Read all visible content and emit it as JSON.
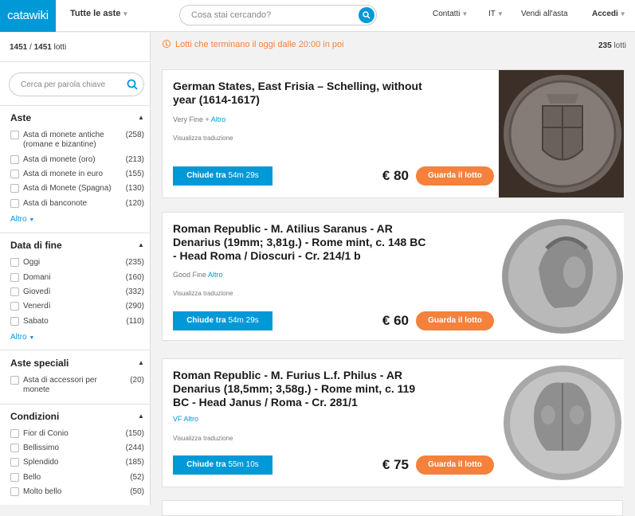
{
  "header": {
    "logo": "catawiki",
    "auctions_menu": "Tutte le aste",
    "search_placeholder": "Cosa stai cercando?",
    "contact": "Contatti",
    "language": "IT",
    "sell": "Vendi all'asta",
    "login": "Accedi"
  },
  "sidebar": {
    "lot_count_shown": "1451",
    "lot_count_total": "1451",
    "lot_word": "lotti",
    "search_placeholder": "Cerca per parola chiave",
    "facets": [
      {
        "title": "Aste",
        "items": [
          {
            "label": "Asta di monete antiche (romane e bizantine)",
            "count": "(258)"
          },
          {
            "label": "Asta di monete (oro)",
            "count": "(213)"
          },
          {
            "label": "Asta di monete in euro",
            "count": "(155)"
          },
          {
            "label": "Asta di Monete (Spagna)",
            "count": "(130)"
          },
          {
            "label": "Asta di banconote",
            "count": "(120)"
          }
        ],
        "more": "Altro"
      },
      {
        "title": "Data di fine",
        "items": [
          {
            "label": "Oggi",
            "count": "(235)"
          },
          {
            "label": "Domani",
            "count": "(160)"
          },
          {
            "label": "Giovedì",
            "count": "(332)"
          },
          {
            "label": "Venerdì",
            "count": "(290)"
          },
          {
            "label": "Sabato",
            "count": "(110)"
          }
        ],
        "more": "Altro"
      },
      {
        "title": "Aste speciali",
        "items": [
          {
            "label": "Asta di accessori per monete",
            "count": "(20)"
          }
        ]
      },
      {
        "title": "Condizioni",
        "items": [
          {
            "label": "Fior di Conio",
            "count": "(150)"
          },
          {
            "label": "Bellissimo",
            "count": "(244)"
          },
          {
            "label": "Splendido",
            "count": "(185)"
          },
          {
            "label": "Bello",
            "count": "(52)"
          },
          {
            "label": "Molto bello",
            "count": "(50)"
          }
        ]
      }
    ]
  },
  "main": {
    "notice": "Lotti che terminano il oggi dalle 20:00 in poi",
    "total_count": "235",
    "total_word": "lotti",
    "lots": [
      {
        "title": "German States, East Frisia – Schelling, without year (1614-1617)",
        "condition": "Very Fine +",
        "more": "Altro",
        "translate": "Visualizza traduzione",
        "timer_label": "Chiude tra",
        "timer_value": "54m 29s",
        "price": "€ 80",
        "cta": "Guarda il lotto",
        "image": "coin-shield-silver"
      },
      {
        "title": "Roman Republic - M. Atilius Saranus - AR Denarius (19mm; 3,81g.) - Rome mint, c. 148 BC - Head Roma / Dioscuri - Cr. 214/1 b",
        "condition": "Good Fine",
        "more": "Altro",
        "translate": "Visualizza traduzione",
        "timer_label": "Chiude tra",
        "timer_value": "54m 29s",
        "price": "€ 60",
        "cta": "Guarda il lotto",
        "image": "coin-roma-head"
      },
      {
        "title": "Roman Republic - M. Furius L.f. Philus - AR Denarius (18,5mm; 3,58g.) - Rome mint, c. 119 BC - Head Janus / Roma - Cr. 281/1",
        "condition": "VF",
        "more": "Altro",
        "translate": "Visualizza traduzione",
        "timer_label": "Chiude tra",
        "timer_value": "55m 10s",
        "price": "€ 75",
        "cta": "Guarda il lotto",
        "image": "coin-janus-head"
      }
    ]
  },
  "colors": {
    "brand_blue": "#0099d8",
    "accent_orange": "#f5813b"
  }
}
